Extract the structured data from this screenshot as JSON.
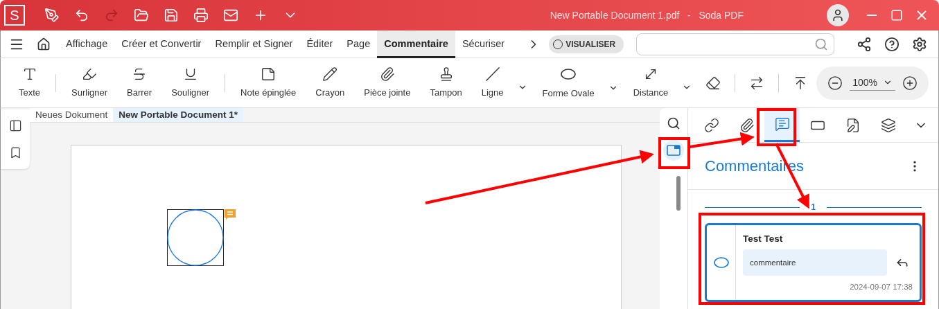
{
  "title_bar": {
    "app_letter": "S",
    "title": "New Portable Document 1.pdf   -   Soda PDF"
  },
  "menu": {
    "tabs": [
      {
        "label": "Affichage",
        "selected": false
      },
      {
        "label": "Créer et Convertir",
        "selected": false
      },
      {
        "label": "Remplir et Signer",
        "selected": false
      },
      {
        "label": "Éditer",
        "selected": false
      },
      {
        "label": "Page",
        "selected": false
      },
      {
        "label": "Commentaire",
        "selected": true
      },
      {
        "label": "Sécuriser",
        "selected": false
      }
    ],
    "preview_toggle": {
      "label": "VISUALISER",
      "on": false
    }
  },
  "toolbar": {
    "tools": [
      {
        "kind": "tool",
        "label": "Texte",
        "dropdown": false
      },
      {
        "kind": "separator"
      },
      {
        "kind": "tool",
        "label": "Surligner",
        "dropdown": false
      },
      {
        "kind": "tool",
        "label": "Barrer",
        "dropdown": false
      },
      {
        "kind": "tool",
        "label": "Souligner",
        "dropdown": false
      },
      {
        "kind": "separator"
      },
      {
        "kind": "tool",
        "label": "Note épinglée",
        "dropdown": false
      },
      {
        "kind": "tool",
        "label": "Crayon",
        "dropdown": false
      },
      {
        "kind": "tool",
        "label": "Pièce jointe",
        "dropdown": false
      },
      {
        "kind": "tool",
        "label": "Tampon",
        "dropdown": false
      },
      {
        "kind": "tool",
        "label": "Ligne",
        "dropdown": true
      },
      {
        "kind": "tool",
        "label": "Forme Ovale",
        "dropdown": true
      },
      {
        "kind": "tool",
        "label": "Distance",
        "dropdown": true
      },
      {
        "kind": "icon"
      },
      {
        "kind": "separator"
      },
      {
        "kind": "icon"
      },
      {
        "kind": "separator"
      },
      {
        "kind": "icon"
      }
    ],
    "zoom": {
      "value": "100%"
    }
  },
  "doc_tabs": [
    {
      "label": "Neues Dokument",
      "selected": false
    },
    {
      "label": "New Portable Document 1*",
      "selected": true
    }
  ],
  "side_rail": {
    "panel_button": {
      "selected": true
    }
  },
  "panel": {
    "tabs": [
      {
        "selected": false
      },
      {
        "selected": false
      },
      {
        "selected": true
      },
      {
        "selected": false
      },
      {
        "selected": false
      },
      {
        "selected": false
      }
    ],
    "title": "Commentaires",
    "page_label": "1",
    "comments": [
      {
        "author": "Test Test",
        "text": "commentaire",
        "time": "2024-09-07 17:38",
        "selected": true
      }
    ]
  }
}
